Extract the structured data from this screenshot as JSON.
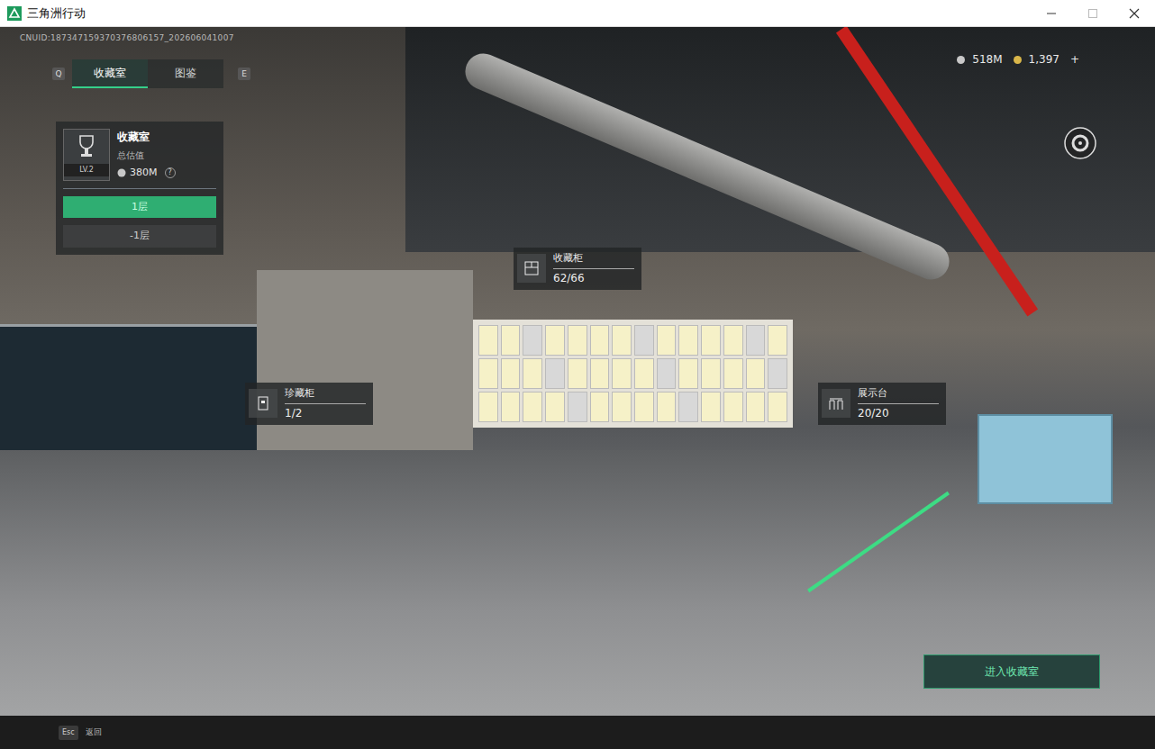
{
  "window": {
    "title": "三角洲行动"
  },
  "uid": "CNUID:187347159370376806157_202606041007",
  "tabs": {
    "prev_key": "Q",
    "next_key": "E",
    "items": [
      {
        "label": "收藏室",
        "selected": true
      },
      {
        "label": "图鉴",
        "selected": false
      }
    ]
  },
  "currency": [
    {
      "amount": "518M",
      "color": "#c8c8c8"
    },
    {
      "amount": "1,397",
      "color": "#d9b64a"
    }
  ],
  "currency_add": "+",
  "room_panel": {
    "title": "收藏室",
    "level": "LV.2",
    "value_label": "总估值",
    "value": "380M",
    "help": "?",
    "floors": [
      {
        "label": "1层",
        "selected": true
      },
      {
        "label": "-1层",
        "selected": false
      }
    ]
  },
  "markers": [
    {
      "label": "收藏柜",
      "count": "62/66"
    },
    {
      "label": "珍藏柜",
      "count": "1/2"
    },
    {
      "label": "展示台",
      "count": "20/20"
    }
  ],
  "enter_button": "进入收藏室",
  "footer": {
    "key": "Esc",
    "label": "返回"
  }
}
